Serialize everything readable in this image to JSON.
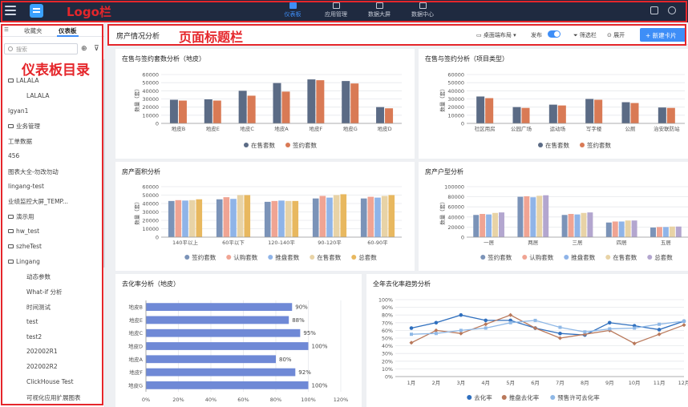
{
  "annotations": {
    "logo": "Logo栏",
    "title": "页面标题栏",
    "directory": "仪表板目录"
  },
  "topnav": {
    "items": [
      {
        "label": "仪表板",
        "active": true
      },
      {
        "label": "应用管理"
      },
      {
        "label": "数据大屏"
      },
      {
        "label": "数据中心"
      }
    ]
  },
  "sidebar": {
    "tabs": [
      "收藏夹",
      "仪表板"
    ],
    "search_placeholder": "搜索",
    "items": [
      {
        "label": "LALALA",
        "folder": true,
        "depth": 0
      },
      {
        "label": "LALALA",
        "depth": 1
      },
      {
        "label": "lgyan1",
        "depth": 0
      },
      {
        "label": "业务管理",
        "folder": true,
        "depth": 0
      },
      {
        "label": "工单数据",
        "depth": 0
      },
      {
        "label": "456",
        "depth": 0
      },
      {
        "label": "图表大全-勿改勿动",
        "depth": 0
      },
      {
        "label": "lingang-test",
        "depth": 0
      },
      {
        "label": "业绩监控大屏_TEMP...",
        "depth": 0
      },
      {
        "label": "演示用",
        "folder": true,
        "depth": 0
      },
      {
        "label": "hw_test",
        "folder": true,
        "depth": 0
      },
      {
        "label": "szheTest",
        "folder": true,
        "depth": 0
      },
      {
        "label": "Lingang",
        "folder": true,
        "depth": 0
      },
      {
        "label": "动态参数",
        "depth": 1
      },
      {
        "label": "What-if 分析",
        "depth": 1
      },
      {
        "label": "时间测试",
        "depth": 1
      },
      {
        "label": "test",
        "depth": 1
      },
      {
        "label": "test2",
        "depth": 1
      },
      {
        "label": "202002R1",
        "depth": 1
      },
      {
        "label": "202002R2",
        "depth": 1
      },
      {
        "label": "ClickHouse Test",
        "depth": 1
      },
      {
        "label": "可视化应用扩展图表",
        "depth": 1
      }
    ]
  },
  "header": {
    "title": "房产情况分析",
    "layout": "桌面端布局",
    "publish": "发布",
    "publish_on": true,
    "filter": "筛选栏",
    "expand": "展开",
    "new_card": "新建卡片"
  },
  "colors": {
    "accent": "#3e8ef7",
    "annotation": "#e5262b",
    "topbar": "#1f2a40"
  },
  "chart_data": [
    {
      "id": "c1",
      "type": "bar",
      "title": "在售与签约套数分析（地皮）",
      "ylabel": "数量（套）",
      "categories": [
        "地皮B",
        "地皮E",
        "地皮C",
        "地皮A",
        "地皮F",
        "地皮G",
        "地皮D"
      ],
      "ylim": [
        0,
        60000
      ],
      "yticks": [
        "0",
        "10000",
        "20000",
        "30000",
        "40000",
        "50000",
        "60000"
      ],
      "series": [
        {
          "name": "在售套数",
          "color": "#5b6b85",
          "values": [
            29000,
            29500,
            40000,
            49500,
            54000,
            52000,
            20000
          ]
        },
        {
          "name": "签约套数",
          "color": "#d97a55",
          "values": [
            28000,
            28000,
            34000,
            39000,
            53000,
            49000,
            18500
          ]
        }
      ]
    },
    {
      "id": "c2",
      "type": "bar",
      "title": "在售与签约分析（项目类型）",
      "ylabel": "数量（套）",
      "categories": [
        "社区用房",
        "公园广场",
        "运动场",
        "写字楼",
        "公厕",
        "治安联防站"
      ],
      "ylim": [
        0,
        60000
      ],
      "yticks": [
        "0",
        "10000",
        "20000",
        "30000",
        "40000",
        "50000",
        "60000"
      ],
      "series": [
        {
          "name": "在售套数",
          "color": "#5b6b85",
          "values": [
            33000,
            20000,
            23000,
            30000,
            26000,
            19500
          ]
        },
        {
          "name": "签约套数",
          "color": "#d97a55",
          "values": [
            31000,
            19000,
            22000,
            29000,
            25000,
            19000
          ]
        }
      ]
    },
    {
      "id": "c3",
      "type": "bar",
      "title": "房产面积分析",
      "ylabel": "数量（套）",
      "categories": [
        "140平以上",
        "60平以下",
        "120-140平",
        "90-120平",
        "60-90平"
      ],
      "ylim": [
        0,
        60000
      ],
      "yticks": [
        "0",
        "10000",
        "20000",
        "30000",
        "40000",
        "50000",
        "60000"
      ],
      "series": [
        {
          "name": "签约套数",
          "color": "#7b93b8",
          "values": [
            43000,
            45000,
            42000,
            46000,
            46000
          ]
        },
        {
          "name": "认购套数",
          "color": "#f0a493",
          "values": [
            44000,
            47500,
            43000,
            49000,
            48000
          ]
        },
        {
          "name": "推盘套数",
          "color": "#8fb4e8",
          "values": [
            43500,
            45500,
            43500,
            47000,
            47000
          ]
        },
        {
          "name": "在售套数",
          "color": "#e8d3a6",
          "values": [
            44000,
            50000,
            43000,
            50000,
            49000
          ]
        },
        {
          "name": "总套数",
          "color": "#e8b85f",
          "values": [
            45000,
            50000,
            43000,
            51000,
            50000
          ]
        }
      ]
    },
    {
      "id": "c4",
      "type": "bar",
      "title": "房产户型分析",
      "ylabel": "数量（套）",
      "categories": [
        "一居",
        "两居",
        "三居",
        "四居",
        "五居"
      ],
      "ylim": [
        0,
        100000
      ],
      "yticks": [
        "0",
        "20000",
        "40000",
        "60000",
        "80000",
        "100000"
      ],
      "series": [
        {
          "name": "签约套数",
          "color": "#7b93b8",
          "values": [
            44000,
            80000,
            44000,
            29000,
            19000
          ]
        },
        {
          "name": "认购套数",
          "color": "#f0a493",
          "values": [
            46000,
            81000,
            46000,
            31000,
            20000
          ]
        },
        {
          "name": "推盘套数",
          "color": "#8fb4e8",
          "values": [
            45000,
            79000,
            45000,
            31000,
            20000
          ]
        },
        {
          "name": "在售套数",
          "color": "#e8d3a6",
          "values": [
            48000,
            82000,
            48000,
            33000,
            21000
          ]
        },
        {
          "name": "总套数",
          "color": "#b3a6cf",
          "values": [
            49000,
            83000,
            49000,
            33000,
            21000
          ]
        }
      ]
    },
    {
      "id": "c5",
      "type": "bar",
      "orientation": "horizontal",
      "title": "去化率分析（地皮）",
      "categories": [
        "地皮B",
        "地皮E",
        "地皮C",
        "地皮D",
        "地皮A",
        "地皮F",
        "地皮G"
      ],
      "values": [
        90,
        88,
        95,
        100,
        80,
        92,
        100
      ],
      "value_labels": [
        "90%",
        "88%",
        "95%",
        "100%",
        "80%",
        "92%",
        "100%"
      ],
      "xlim": [
        0,
        120
      ],
      "xticks": [
        "0%",
        "20%",
        "40%",
        "60%",
        "80%",
        "100%",
        "120%"
      ],
      "color": "#6f89d6"
    },
    {
      "id": "c6",
      "type": "line",
      "title": "全年去化率趋势分析",
      "categories": [
        "1月",
        "2月",
        "3月",
        "4月",
        "5月",
        "6月",
        "7月",
        "8月",
        "9月",
        "10月",
        "11月",
        "12月"
      ],
      "ylim": [
        0,
        100
      ],
      "yticks": [
        "0%",
        "10%",
        "20%",
        "30%",
        "40%",
        "50%",
        "60%",
        "70%",
        "80%",
        "90%",
        "100%"
      ],
      "series": [
        {
          "name": "去化率",
          "color": "#2f6fbe",
          "marker": "circle",
          "values": [
            63,
            70,
            80,
            73,
            73,
            63,
            56,
            54,
            70,
            66,
            61,
            72
          ]
        },
        {
          "name": "推盘去化率",
          "color": "#b9785a",
          "marker": "diamond",
          "values": [
            44,
            60,
            56,
            68,
            80,
            63,
            50,
            55,
            60,
            43,
            55,
            67
          ]
        },
        {
          "name": "预售许可去化率",
          "color": "#8fb8e6",
          "marker": "square",
          "values": [
            55,
            56,
            60,
            63,
            70,
            73,
            64,
            58,
            62,
            63,
            68,
            72
          ]
        }
      ]
    }
  ]
}
